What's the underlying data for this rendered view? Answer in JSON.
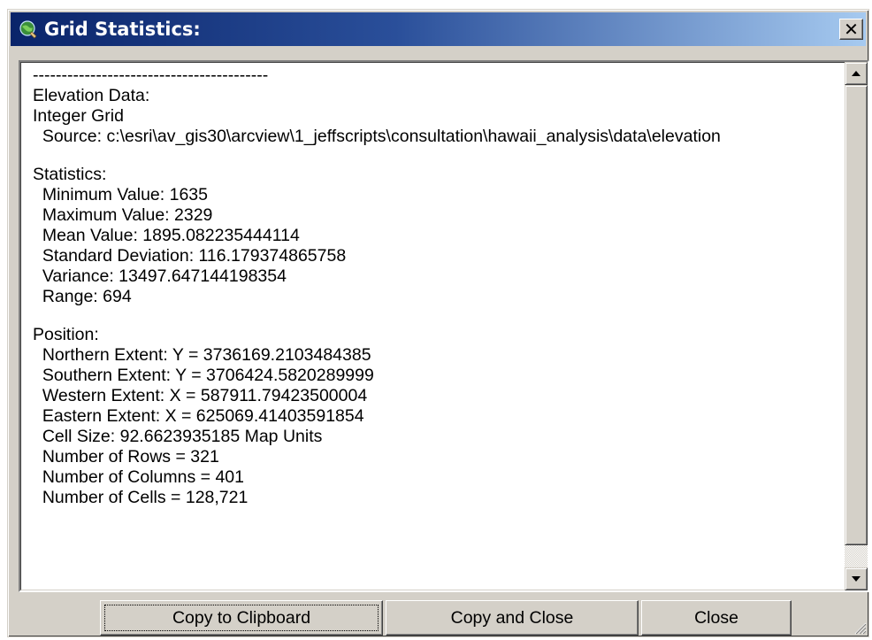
{
  "window": {
    "title": "Grid Statistics:",
    "close_glyph": "✕",
    "title_icon": "globe-icon"
  },
  "report": {
    "lines": [
      "-----------------------------------------",
      "Elevation Data:",
      "Integer Grid",
      "  Source: c:\\esri\\av_gis30\\arcview\\1_jeffscripts\\consultation\\hawaii_analysis\\data\\elevation",
      "",
      "Statistics:",
      "  Minimum Value: 1635",
      "  Maximum Value: 2329",
      "  Mean Value: 1895.082235444114",
      "  Standard Deviation: 116.179374865758",
      "  Variance: 13497.647144198354",
      "  Range: 694",
      "",
      "Position:",
      "  Northern Extent: Y = 3736169.2103484385",
      "  Southern Extent: Y = 3706424.5820289999",
      "  Western Extent: X = 587911.79423500004",
      "  Eastern Extent: X = 625069.41403591854",
      "  Cell Size: 92.6623935185 Map Units",
      "  Number of Rows = 321",
      "  Number of Columns = 401",
      "  Number of Cells = 128,721"
    ]
  },
  "scrollbar": {
    "up_icon": "arrow-up-icon",
    "down_icon": "arrow-down-icon",
    "thumb_position": 0.0
  },
  "buttons": {
    "copy_to_clipboard": "Copy to Clipboard",
    "copy_and_close": "Copy and Close",
    "close": "Close"
  },
  "colors": {
    "title_start": "#0a246a",
    "title_end": "#a6caf0",
    "face": "#d4d0c8"
  }
}
